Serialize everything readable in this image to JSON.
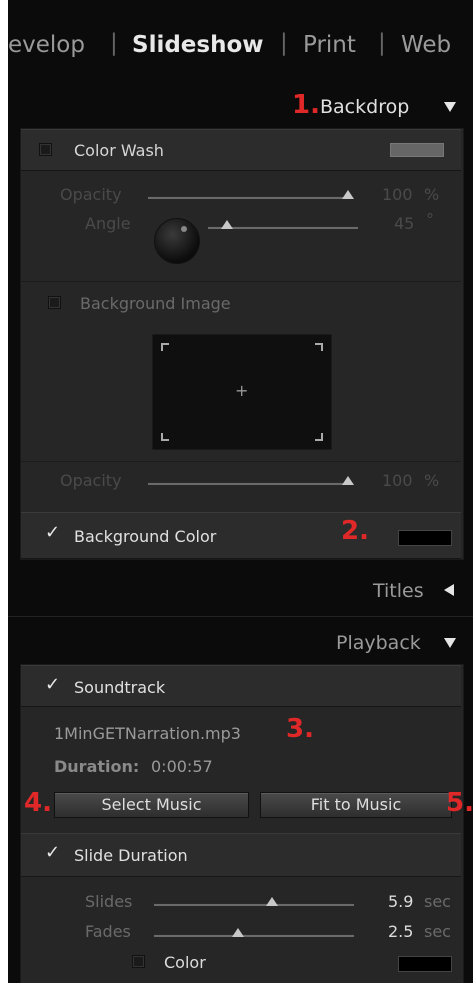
{
  "modules": [
    {
      "label": "evelop",
      "active": false
    },
    {
      "label": "Slideshow",
      "active": true
    },
    {
      "label": "Print",
      "active": false
    },
    {
      "label": "Web",
      "active": false
    }
  ],
  "module_separator": "|",
  "backdrop": {
    "header": "Backdrop",
    "marker": "1.",
    "color_wash": {
      "label": "Color Wash",
      "checked": false,
      "opacity_label": "Opacity",
      "opacity_value": "100",
      "opacity_unit": "%",
      "opacity_level": 1.0,
      "angle_label": "Angle",
      "angle_value": "45",
      "angle_unit": "°",
      "angle_level": 0.125
    },
    "background_image": {
      "label": "Background Image",
      "checked": false,
      "drop_plus": "+",
      "opacity_label": "Opacity",
      "opacity_value": "100",
      "opacity_unit": "%",
      "opacity_level": 1.0
    },
    "background_color": {
      "label": "Background Color",
      "checked": true,
      "marker": "2.",
      "color": "#000000"
    }
  },
  "titles": {
    "header": "Titles"
  },
  "playback": {
    "header": "Playback",
    "soundtrack": {
      "label": "Soundtrack",
      "checked": true,
      "filename": "1MinGETNarration.mp3",
      "marker": "3.",
      "duration_label": "Duration:",
      "duration_value": "0:00:57",
      "select_button": "Select Music",
      "select_marker": "4.",
      "fit_button": "Fit to Music",
      "fit_marker": "5."
    },
    "slide_duration": {
      "label": "Slide Duration",
      "checked": true,
      "slides_label": "Slides",
      "slides_value": "5.9",
      "slides_unit": "sec",
      "slides_level": 0.59,
      "fades_label": "Fades",
      "fades_value": "2.5",
      "fades_unit": "sec",
      "fades_level": 0.42,
      "color_label": "Color",
      "color_checked": false,
      "color": "#000000"
    }
  },
  "colors": {
    "background": "#0b0b0b",
    "panel": "#262626",
    "accent_marker": "#e02828"
  }
}
